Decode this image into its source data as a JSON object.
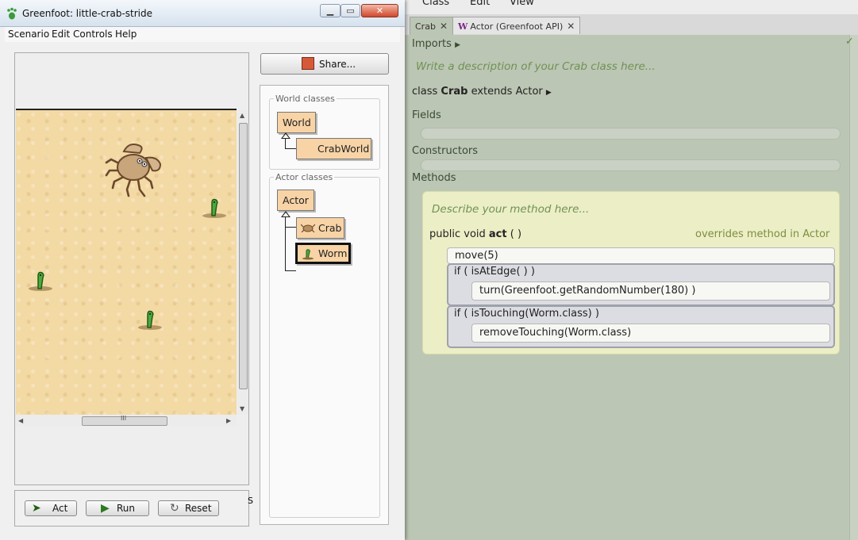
{
  "greenfoot": {
    "title": "Greenfoot: little-crab-stride",
    "menu": [
      "Scenario",
      "Edit",
      "Controls",
      "Help"
    ],
    "window_buttons": [
      "minimize-button",
      "maximize-button",
      "close-button"
    ],
    "share_label": "Share...",
    "controls": {
      "act": "Act",
      "run": "Run",
      "reset": "Reset",
      "speed_label": "S"
    },
    "world_classes": {
      "title": "World classes",
      "items": [
        "World",
        "CrabWorld"
      ]
    },
    "actor_classes": {
      "title": "Actor classes",
      "items": [
        "Actor",
        "Crab",
        "Worm"
      ],
      "selected": "Worm"
    },
    "scroll_grip": "III"
  },
  "editor": {
    "menu": [
      "Class",
      "Edit",
      "View"
    ],
    "tabs": [
      {
        "label": "Crab",
        "active": true
      },
      {
        "label": "Actor (Greenfoot API)",
        "icon": "W",
        "active": false
      }
    ],
    "imports_label": "Imports",
    "class_description": "Write a description of your Crab class here...",
    "class_decl": {
      "kw": "class",
      "name": "Crab",
      "extends_kw": "extends",
      "parent": "Actor"
    },
    "fields_label": "Fields",
    "constructors_label": "Constructors",
    "methods_label": "Methods",
    "method": {
      "description": "Describe your method here...",
      "signature": {
        "modifiers": "public void",
        "name": "act",
        "params": "( )"
      },
      "overrides": "overrides method in Actor",
      "statements": {
        "move": {
          "name": "move",
          "args": "(5)"
        },
        "if1": {
          "kw": "if",
          "cond_open": "(",
          "cond": "isAtEdge",
          "cond_args": "( )",
          "cond_close": ")",
          "body_name": "turn",
          "body_args": "(Greenfoot.getRandomNumber(180) )"
        },
        "if2": {
          "kw": "if",
          "cond_open": "(",
          "cond": "isTouching",
          "cond_args": "(Worm.class)",
          "cond_close": ")",
          "body_name": "removeTouching",
          "body_args": "(Worm.class)"
        }
      }
    },
    "check_mark": "✓"
  },
  "colors": {
    "editor_bg": "#bcc6b4",
    "method_bg": "#eceec6",
    "description_green": "#6f9254",
    "class_box": "#f7d3a6"
  }
}
